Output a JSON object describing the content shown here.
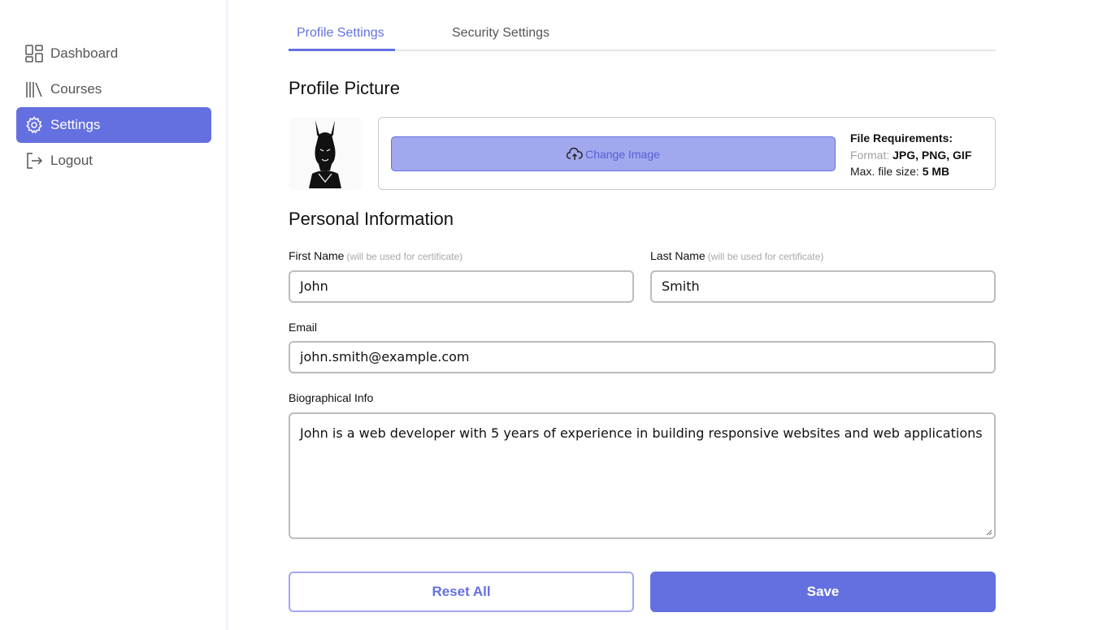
{
  "sidebar": {
    "items": [
      {
        "label": "Dashboard",
        "icon": "dashboard-icon",
        "active": false
      },
      {
        "label": "Courses",
        "icon": "library-icon",
        "active": false
      },
      {
        "label": "Settings",
        "icon": "gear-icon",
        "active": true
      },
      {
        "label": "Logout",
        "icon": "logout-icon",
        "active": false
      }
    ]
  },
  "tabs": [
    {
      "label": "Profile Settings",
      "active": true
    },
    {
      "label": "Security Settings",
      "active": false
    }
  ],
  "profile_picture": {
    "title": "Profile Picture",
    "change_button": "Change Image",
    "requirements": {
      "title": "File Requirements:",
      "format_label": "Format:",
      "format_value": "JPG, PNG, GIF",
      "size_label": "Max. file size:",
      "size_value": "5 MB"
    }
  },
  "personal_info": {
    "title": "Personal Information",
    "first_name": {
      "label": "First Name",
      "hint": "(will be used for certificate)",
      "value": "John"
    },
    "last_name": {
      "label": "Last Name",
      "hint": "(will be used for certificate)",
      "value": "Smith"
    },
    "email": {
      "label": "Email",
      "value": "john.smith@example.com"
    },
    "bio": {
      "label": "Biographical Info",
      "value": "John is a web developer with 5 years of experience in building responsive websites and web applications"
    }
  },
  "actions": {
    "reset": "Reset All",
    "save": "Save"
  },
  "colors": {
    "accent": "#6470e0",
    "accent_light": "#a1a8ee"
  }
}
